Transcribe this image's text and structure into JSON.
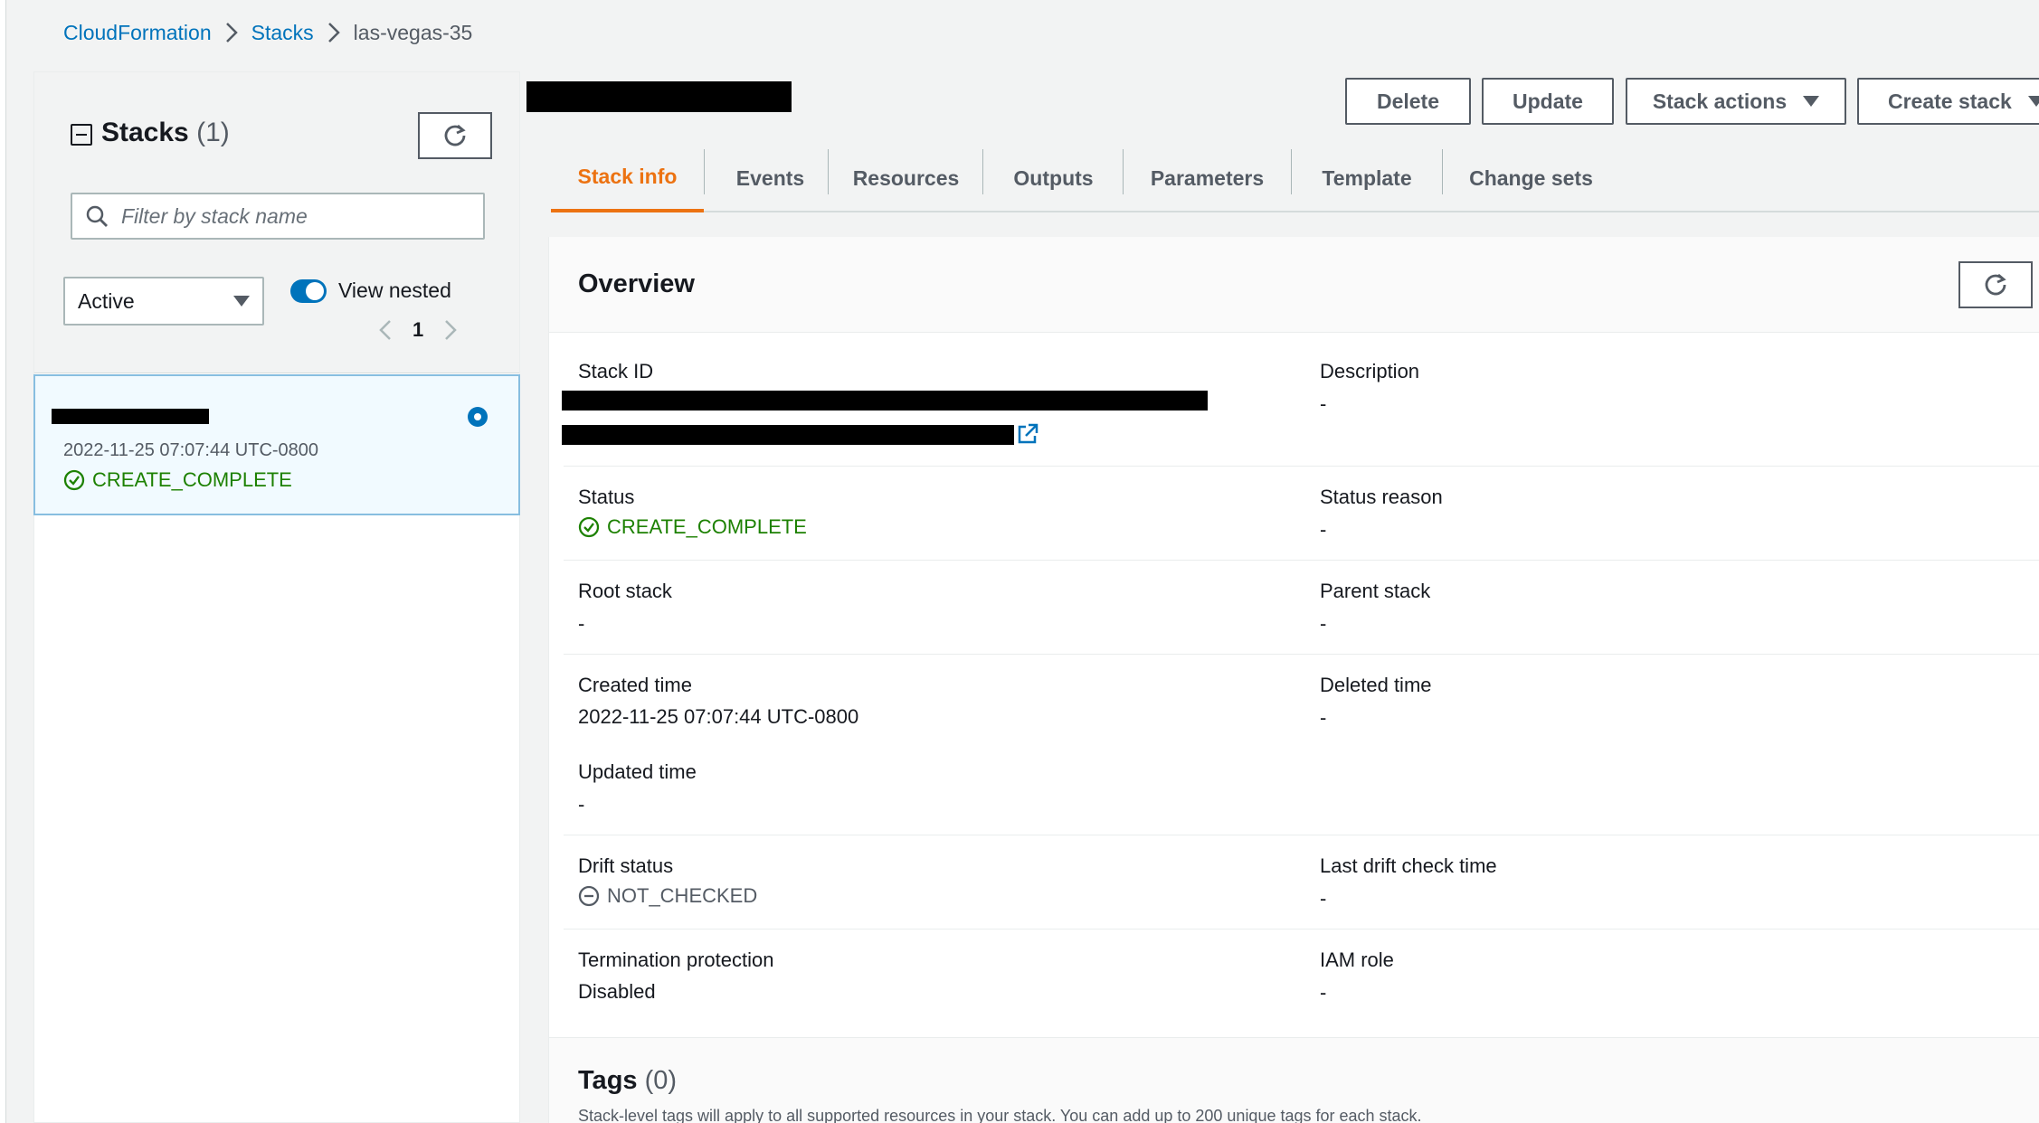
{
  "breadcrumb": {
    "items": [
      "CloudFormation",
      "Stacks"
    ],
    "current": "las-vegas-35"
  },
  "stacks_panel": {
    "title": "Stacks",
    "count": "(1)",
    "search_placeholder": "Filter by stack name",
    "filter_value": "Active",
    "toggle_label": "View nested",
    "page": "1",
    "card": {
      "date": "2022-11-25 07:07:44 UTC-0800",
      "status": "CREATE_COMPLETE"
    }
  },
  "actions": {
    "delete": "Delete",
    "update": "Update",
    "stack_actions": "Stack actions",
    "create_stack": "Create stack"
  },
  "tabs": [
    "Stack info",
    "Events",
    "Resources",
    "Outputs",
    "Parameters",
    "Template",
    "Change sets"
  ],
  "overview": {
    "title": "Overview",
    "stack_id_label": "Stack ID",
    "description_label": "Description",
    "description_value": "-",
    "status_label": "Status",
    "status_value": "CREATE_COMPLETE",
    "status_reason_label": "Status reason",
    "status_reason_value": "-",
    "root_stack_label": "Root stack",
    "root_stack_value": "-",
    "parent_stack_label": "Parent stack",
    "parent_stack_value": "-",
    "created_time_label": "Created time",
    "created_time_value": "2022-11-25 07:07:44 UTC-0800",
    "deleted_time_label": "Deleted time",
    "deleted_time_value": "-",
    "updated_time_label": "Updated time",
    "updated_time_value": "-",
    "drift_status_label": "Drift status",
    "drift_status_value": "NOT_CHECKED",
    "last_drift_label": "Last drift check time",
    "last_drift_value": "-",
    "termination_label": "Termination protection",
    "termination_value": "Disabled",
    "iam_role_label": "IAM role",
    "iam_role_value": "-"
  },
  "tags": {
    "title": "Tags",
    "count": "(0)",
    "description": "Stack-level tags will apply to all supported resources in your stack. You can add up to 200 unique tags for each stack."
  },
  "colors": {
    "link": "#0073bb",
    "success": "#1d8102",
    "active_tab": "#ec7211"
  }
}
